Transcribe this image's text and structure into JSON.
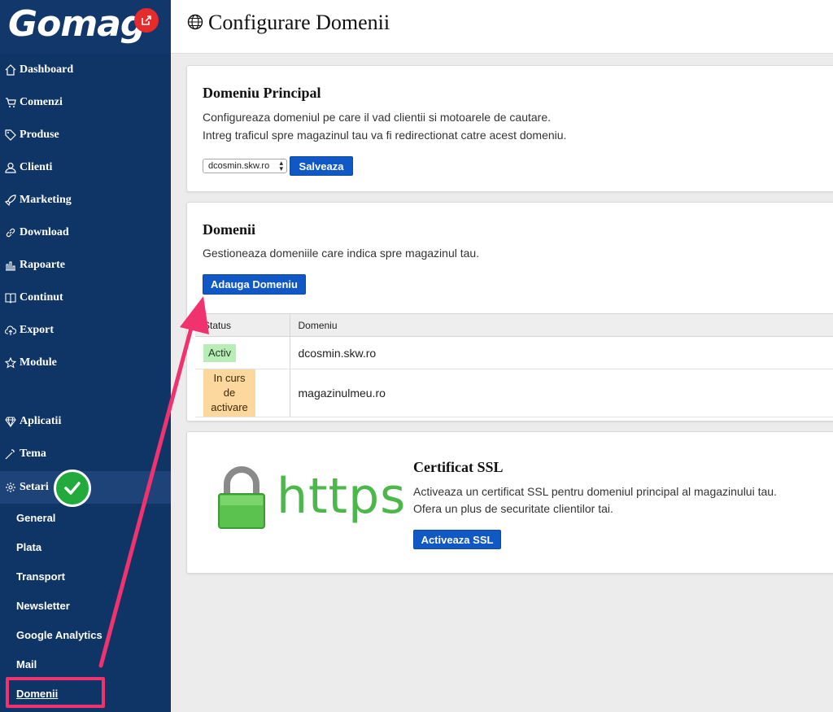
{
  "brand": {
    "logo": "Gomag",
    "accent": "#1158c7",
    "sidebar_bg": "#0f3566"
  },
  "sidebar": {
    "items": [
      {
        "label": "Dashboard",
        "icon": "home-icon"
      },
      {
        "label": "Comenzi",
        "icon": "cart-icon"
      },
      {
        "label": "Produse",
        "icon": "tag-icon"
      },
      {
        "label": "Clienti",
        "icon": "user-icon"
      },
      {
        "label": "Marketing",
        "icon": "rocket-icon"
      },
      {
        "label": "Download",
        "icon": "link-icon"
      },
      {
        "label": "Rapoarte",
        "icon": "bar-chart-icon"
      },
      {
        "label": "Continut",
        "icon": "book-icon"
      },
      {
        "label": "Export",
        "icon": "cloud-upload-icon"
      },
      {
        "label": "Module",
        "icon": "star-icon"
      },
      {
        "label": "Aplicatii",
        "icon": "diamond-icon"
      },
      {
        "label": "Tema",
        "icon": "wand-icon"
      },
      {
        "label": "Setari",
        "icon": "gear-icon"
      }
    ],
    "subitems": [
      "General",
      "Plata",
      "Transport",
      "Newsletter",
      "Google Analytics",
      "Mail",
      "Domenii"
    ]
  },
  "header": {
    "title": "Configurare Domenii"
  },
  "main_domain": {
    "title": "Domeniu Principal",
    "desc1": "Configureaza domeniul pe care il vad clientii si motoarele de cautare.",
    "desc2": "Intreg traficul spre magazinul tau va fi redirectionat catre acest domeniu.",
    "selected": "dcosmin.skw.ro",
    "save_label": "Salveaza"
  },
  "domains": {
    "title": "Domenii",
    "desc": "Gestioneaza domeniile care indica spre magazinul tau.",
    "add_label": "Adauga Domeniu",
    "columns": [
      "Status",
      "Domeniu"
    ],
    "rows": [
      {
        "status": "Activ",
        "domain": "dcosmin.skw.ro"
      },
      {
        "status": "In curs de activare",
        "domain": "magazinulmeu.ro"
      }
    ]
  },
  "ssl": {
    "title": "Certificat SSL",
    "image_text": "https",
    "desc1": "Activeaza un certificat SSL pentru domeniul principal al magazinului tau.",
    "desc2": "Ofera un plus de securitate clientilor tai.",
    "button_label": "Activeaza SSL"
  }
}
